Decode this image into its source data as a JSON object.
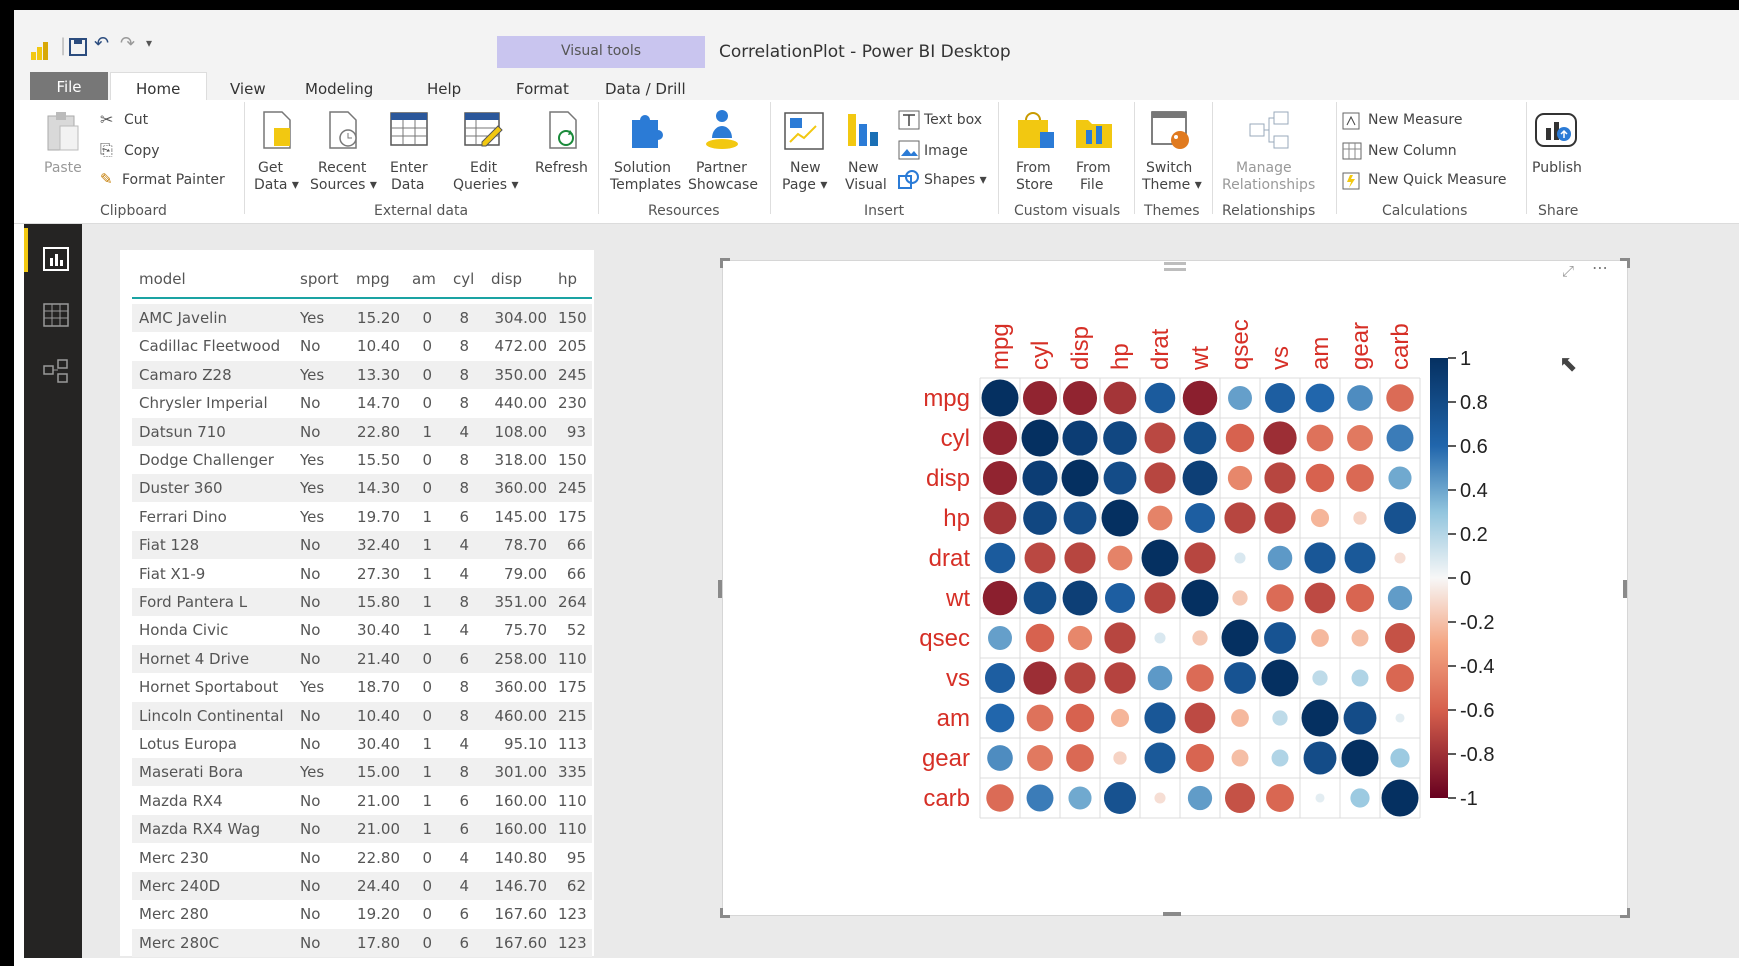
{
  "app": {
    "title": "CorrelationPlot - Power BI Desktop",
    "context_group": "Visual tools"
  },
  "tabs": {
    "file": "File",
    "home": "Home",
    "view": "View",
    "modeling": "Modeling",
    "help": "Help",
    "format": "Format",
    "data_drill": "Data / Drill"
  },
  "ribbon": {
    "clipboard": {
      "paste": "Paste",
      "cut": "Cut",
      "copy": "Copy",
      "format_painter": "Format Painter",
      "group": "Clipboard"
    },
    "external_data": {
      "get_data_1": "Get",
      "get_data_2": "Data ▾",
      "recent_1": "Recent",
      "recent_2": "Sources ▾",
      "enter_1": "Enter",
      "enter_2": "Data",
      "edit_1": "Edit",
      "edit_2": "Queries ▾",
      "refresh": "Refresh",
      "group": "External data"
    },
    "resources": {
      "solution_1": "Solution",
      "solution_2": "Templates",
      "partner_1": "Partner",
      "partner_2": "Showcase",
      "group": "Resources"
    },
    "insert": {
      "new_page_1": "New",
      "new_page_2": "Page ▾",
      "new_visual_1": "New",
      "new_visual_2": "Visual",
      "text_box": "Text box",
      "image": "Image",
      "shapes": "Shapes ▾",
      "group": "Insert"
    },
    "custom_visuals": {
      "from_store_1": "From",
      "from_store_2": "Store",
      "from_file_1": "From",
      "from_file_2": "File",
      "group": "Custom visuals"
    },
    "themes": {
      "switch_1": "Switch",
      "switch_2": "Theme ▾",
      "group": "Themes"
    },
    "relationships": {
      "manage_1": "Manage",
      "manage_2": "Relationships",
      "group": "Relationships"
    },
    "calculations": {
      "new_measure": "New Measure",
      "new_column": "New Column",
      "new_quick_measure": "New Quick Measure",
      "group": "Calculations"
    },
    "share": {
      "publish": "Publish",
      "group": "Share"
    }
  },
  "table": {
    "headers": [
      "model",
      "sport",
      "mpg",
      "am",
      "cyl",
      "disp",
      "hp"
    ],
    "rows": [
      [
        "AMC Javelin",
        "Yes",
        "15.20",
        "0",
        "8",
        "304.00",
        "150"
      ],
      [
        "Cadillac Fleetwood",
        "No",
        "10.40",
        "0",
        "8",
        "472.00",
        "205"
      ],
      [
        "Camaro Z28",
        "Yes",
        "13.30",
        "0",
        "8",
        "350.00",
        "245"
      ],
      [
        "Chrysler Imperial",
        "No",
        "14.70",
        "0",
        "8",
        "440.00",
        "230"
      ],
      [
        "Datsun 710",
        "No",
        "22.80",
        "1",
        "4",
        "108.00",
        "93"
      ],
      [
        "Dodge Challenger",
        "Yes",
        "15.50",
        "0",
        "8",
        "318.00",
        "150"
      ],
      [
        "Duster 360",
        "Yes",
        "14.30",
        "0",
        "8",
        "360.00",
        "245"
      ],
      [
        "Ferrari Dino",
        "Yes",
        "19.70",
        "1",
        "6",
        "145.00",
        "175"
      ],
      [
        "Fiat 128",
        "No",
        "32.40",
        "1",
        "4",
        "78.70",
        "66"
      ],
      [
        "Fiat X1-9",
        "No",
        "27.30",
        "1",
        "4",
        "79.00",
        "66"
      ],
      [
        "Ford Pantera L",
        "No",
        "15.80",
        "1",
        "8",
        "351.00",
        "264"
      ],
      [
        "Honda Civic",
        "No",
        "30.40",
        "1",
        "4",
        "75.70",
        "52"
      ],
      [
        "Hornet 4 Drive",
        "No",
        "21.40",
        "0",
        "6",
        "258.00",
        "110"
      ],
      [
        "Hornet Sportabout",
        "Yes",
        "18.70",
        "0",
        "8",
        "360.00",
        "175"
      ],
      [
        "Lincoln Continental",
        "No",
        "10.40",
        "0",
        "8",
        "460.00",
        "215"
      ],
      [
        "Lotus Europa",
        "No",
        "30.40",
        "1",
        "4",
        "95.10",
        "113"
      ],
      [
        "Maserati Bora",
        "Yes",
        "15.00",
        "1",
        "8",
        "301.00",
        "335"
      ],
      [
        "Mazda RX4",
        "No",
        "21.00",
        "1",
        "6",
        "160.00",
        "110"
      ],
      [
        "Mazda RX4 Wag",
        "No",
        "21.00",
        "1",
        "6",
        "160.00",
        "110"
      ],
      [
        "Merc 230",
        "No",
        "22.80",
        "0",
        "4",
        "140.80",
        "95"
      ],
      [
        "Merc 240D",
        "No",
        "24.40",
        "0",
        "4",
        "146.70",
        "62"
      ],
      [
        "Merc 280",
        "No",
        "19.20",
        "0",
        "6",
        "167.60",
        "123"
      ],
      [
        "Merc 280C",
        "No",
        "17.80",
        "0",
        "6",
        "167.60",
        "123"
      ]
    ]
  },
  "chart_data": {
    "type": "heatmap",
    "variables": [
      "mpg",
      "cyl",
      "disp",
      "hp",
      "drat",
      "wt",
      "qsec",
      "vs",
      "am",
      "gear",
      "carb"
    ],
    "matrix": [
      [
        1,
        -0.85,
        -0.85,
        -0.78,
        0.68,
        -0.87,
        0.42,
        0.66,
        0.6,
        0.48,
        -0.55
      ],
      [
        -0.85,
        1,
        0.9,
        0.83,
        -0.7,
        0.78,
        -0.59,
        -0.81,
        -0.52,
        -0.49,
        0.53
      ],
      [
        -0.85,
        0.9,
        1,
        0.79,
        -0.71,
        0.89,
        -0.43,
        -0.71,
        -0.59,
        -0.56,
        0.39
      ],
      [
        -0.78,
        0.83,
        0.79,
        1,
        -0.45,
        0.66,
        -0.71,
        -0.72,
        -0.24,
        -0.13,
        0.75
      ],
      [
        0.68,
        -0.7,
        -0.71,
        -0.45,
        1,
        -0.71,
        0.09,
        0.44,
        0.71,
        0.7,
        -0.09
      ],
      [
        -0.87,
        0.78,
        0.89,
        0.66,
        -0.71,
        1,
        -0.17,
        -0.55,
        -0.69,
        -0.58,
        0.43
      ],
      [
        0.42,
        -0.59,
        -0.43,
        -0.71,
        0.09,
        -0.17,
        1,
        0.74,
        -0.23,
        -0.21,
        -0.66
      ],
      [
        0.66,
        -0.81,
        -0.71,
        -0.72,
        0.44,
        -0.55,
        0.74,
        1,
        0.17,
        0.21,
        -0.57
      ],
      [
        0.6,
        -0.52,
        -0.59,
        -0.24,
        0.71,
        -0.69,
        -0.23,
        0.17,
        1,
        0.79,
        0.06
      ],
      [
        0.48,
        -0.49,
        -0.56,
        -0.13,
        0.7,
        -0.58,
        -0.21,
        0.21,
        0.79,
        1,
        0.27
      ],
      [
        -0.55,
        0.53,
        0.39,
        0.75,
        -0.09,
        0.43,
        -0.66,
        -0.57,
        0.06,
        0.27,
        1
      ]
    ],
    "colorbar_ticks": [
      "1",
      "0.8",
      "0.6",
      "0.4",
      "0.2",
      "0",
      "-0.2",
      "-0.4",
      "-0.6",
      "-0.8",
      "-1"
    ],
    "range": [
      -1,
      1
    ],
    "label_color": "#d62f26",
    "colors": {
      "positive": "#053061",
      "neutral": "#f7f7f7",
      "negative": "#67001f"
    }
  }
}
